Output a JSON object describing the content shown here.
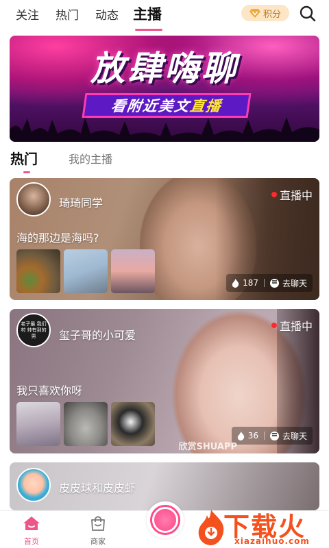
{
  "top_nav": {
    "tabs": [
      {
        "label": "关注"
      },
      {
        "label": "热门"
      },
      {
        "label": "动态"
      },
      {
        "label": "主播"
      }
    ],
    "active_tab": "主播",
    "points_label": "积分"
  },
  "banner": {
    "title": "放肆嗨聊",
    "subtitle_prefix": "看附近美文",
    "subtitle_highlight": "直播"
  },
  "sub_tabs": {
    "hot": "热门",
    "mine": "我的主播"
  },
  "cards": [
    {
      "name": "琦琦同学",
      "status": "直播中",
      "caption": "海的那边是海吗?",
      "heat": "187",
      "chat_label": "去聊天",
      "thumbs": [
        "food",
        "sky",
        "sunset"
      ]
    },
    {
      "name": "玺子哥的小可爱",
      "status": "直播中",
      "caption": "我只喜欢你呀",
      "heat": "36",
      "chat_label": "去聊天",
      "thumbs": [
        "anime",
        "cat-gray",
        "cat-bw"
      ],
      "watermark": "欣赏SHUAPP",
      "avatar_text": "老子最 我们村 帅有到的男"
    },
    {
      "name": "皮皮球和皮皮虾"
    }
  ],
  "bottom_bar": {
    "home": "首页",
    "shop": "商家"
  },
  "promo": {
    "brand": "下载火",
    "url": "xiazaihuo.com"
  },
  "colors": {
    "accent": "#f0558a",
    "points_bg": "#fde6c5",
    "live_dot": "#ff2a2a",
    "promo": "#f4511e"
  }
}
